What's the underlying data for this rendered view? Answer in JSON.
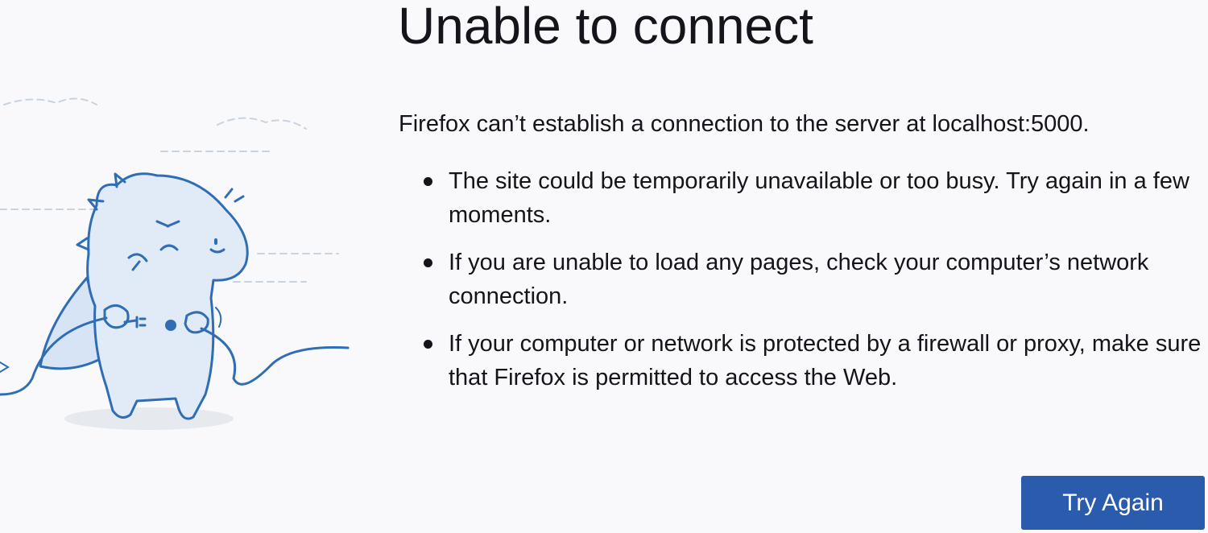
{
  "page": {
    "title": "Unable to connect",
    "intro": "Firefox can’t establish a connection to the server at localhost:5000.",
    "reasons": [
      "The site could be temporarily unavailable or too busy. Try again in a few moments.",
      "If you are unable to load any pages, check your computer’s network connection.",
      "If your computer or network is protected by a firewall or proxy, make sure that Firefox is permitted to access the Web."
    ],
    "try_again_label": "Try Again"
  },
  "colors": {
    "background": "#f9f9fb",
    "text": "#15141a",
    "button": "#2b5bad",
    "button_text": "#ffffff",
    "illustration_stroke": "#2f6db5",
    "illustration_fill": "#e1ebf7"
  },
  "illustration": {
    "name": "dino-unplugged-icon"
  }
}
